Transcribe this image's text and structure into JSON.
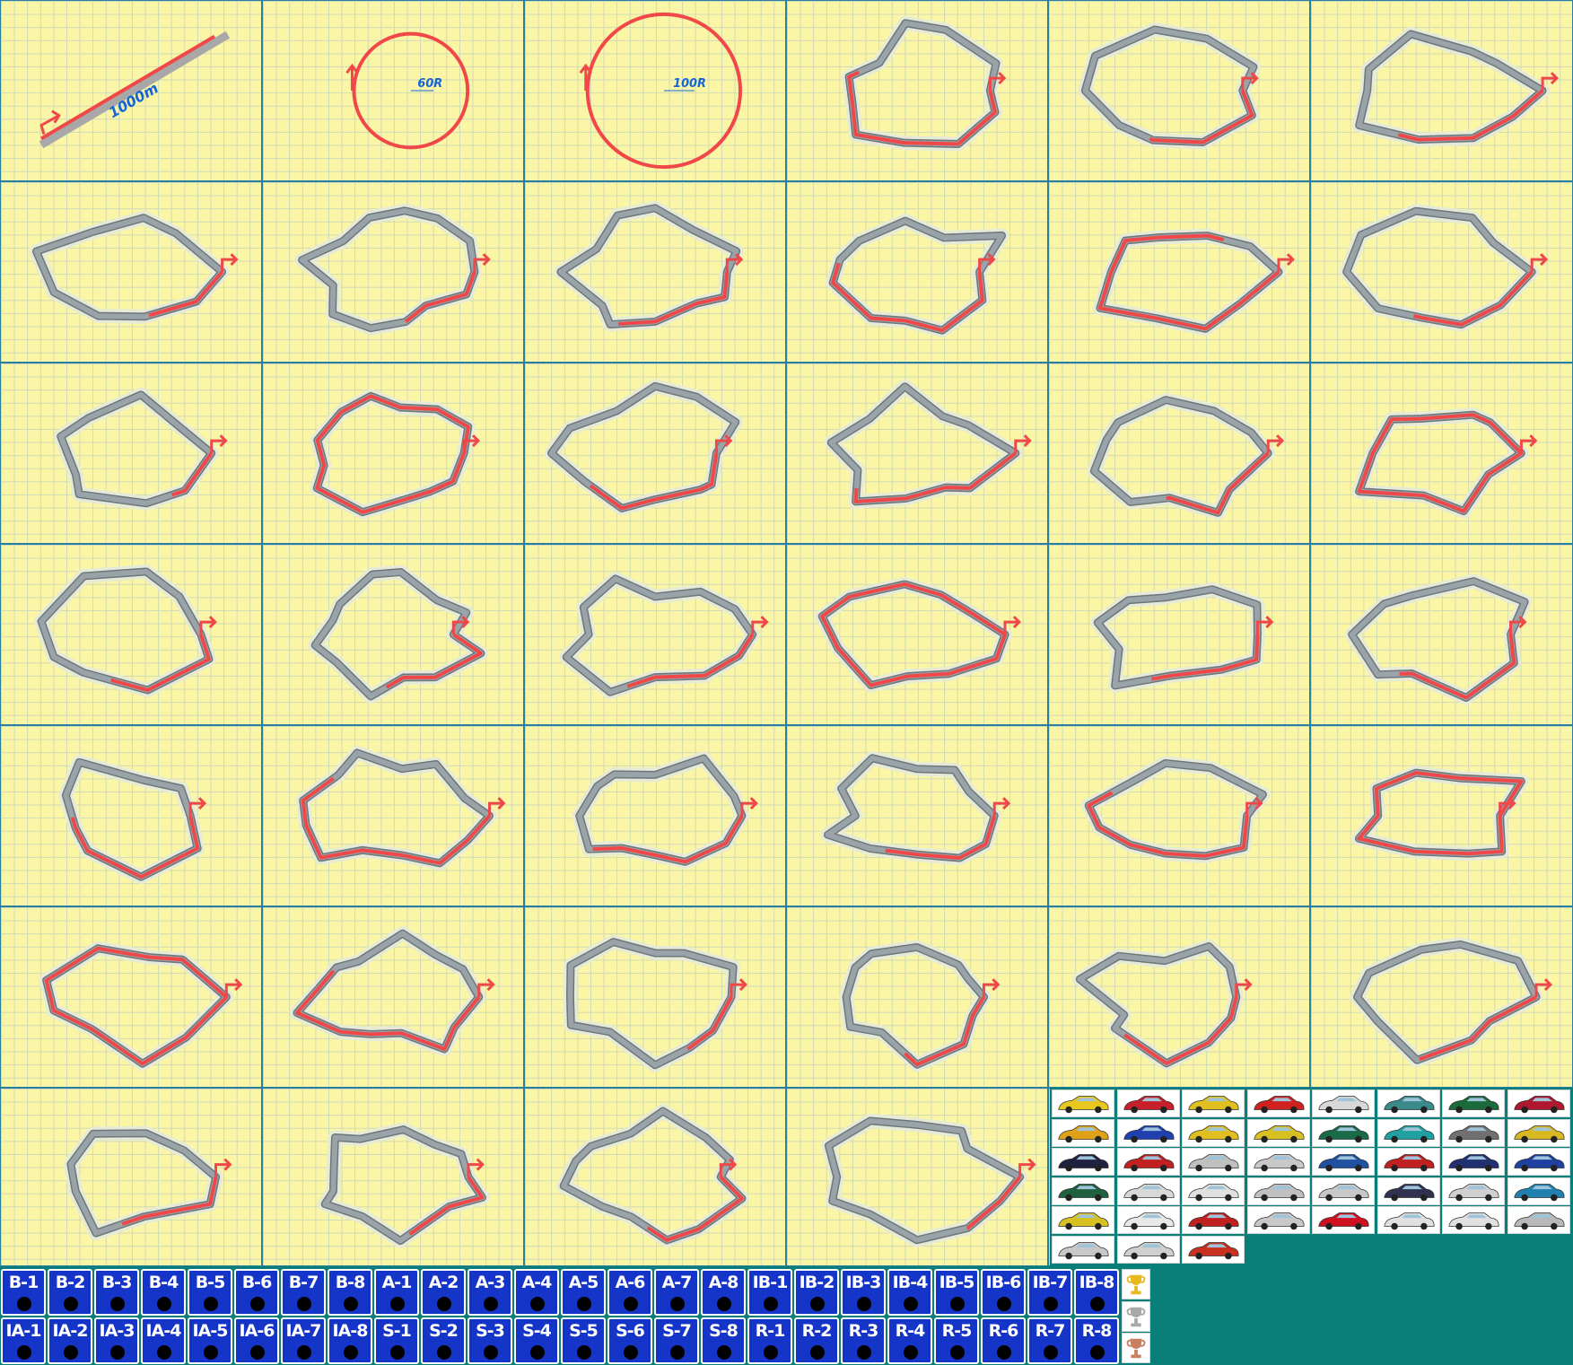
{
  "tracks": [
    {
      "type": "strip",
      "label": "1000m"
    },
    {
      "type": "ring",
      "label": "60R"
    },
    {
      "type": "ring",
      "label": "100R"
    },
    {
      "type": "circuit",
      "seed": 1,
      "highlight": 0.55
    },
    {
      "type": "circuit",
      "seed": 2,
      "highlight": 0.3
    },
    {
      "type": "circuit",
      "seed": 3,
      "highlight": 0.35
    },
    {
      "type": "circuit",
      "seed": 4,
      "highlight": 0.2
    },
    {
      "type": "circuit",
      "seed": 5,
      "highlight": 0.2
    },
    {
      "type": "circuit",
      "seed": 6,
      "highlight": 0.3
    },
    {
      "type": "circuit",
      "seed": 7,
      "highlight": 0.5
    },
    {
      "type": "circuit",
      "seed": 8,
      "highlight": 0.85
    },
    {
      "type": "circuit",
      "seed": 9,
      "highlight": 0.3
    },
    {
      "type": "circuit",
      "seed": 10,
      "highlight": 0.15
    },
    {
      "type": "circuit",
      "seed": 11,
      "highlight": 1
    },
    {
      "type": "circuit",
      "seed": 12,
      "highlight": 0.35
    },
    {
      "type": "circuit",
      "seed": 13,
      "highlight": 0.4
    },
    {
      "type": "circuit",
      "seed": 14,
      "highlight": 0.3
    },
    {
      "type": "circuit",
      "seed": 15,
      "highlight": 1
    },
    {
      "type": "circuit",
      "seed": 16,
      "highlight": 0.3
    },
    {
      "type": "circuit",
      "seed": 17,
      "highlight": 0.3
    },
    {
      "type": "circuit",
      "seed": 18,
      "highlight": 0.3
    },
    {
      "type": "circuit",
      "seed": 19,
      "highlight": 1
    },
    {
      "type": "circuit",
      "seed": 20,
      "highlight": 0.3
    },
    {
      "type": "circuit",
      "seed": 21,
      "highlight": 0.35
    },
    {
      "type": "circuit",
      "seed": 22,
      "highlight": 0.5
    },
    {
      "type": "circuit",
      "seed": 23,
      "highlight": 0.6
    },
    {
      "type": "circuit",
      "seed": 24,
      "highlight": 0.4
    },
    {
      "type": "circuit",
      "seed": 25,
      "highlight": 0.3
    },
    {
      "type": "circuit",
      "seed": 26,
      "highlight": 0.55
    },
    {
      "type": "circuit",
      "seed": 27,
      "highlight": 1
    },
    {
      "type": "circuit",
      "seed": 28,
      "highlight": 1
    },
    {
      "type": "circuit",
      "seed": 29,
      "highlight": 0.6
    },
    {
      "type": "circuit",
      "seed": 30,
      "highlight": 0.15
    },
    {
      "type": "circuit",
      "seed": 31,
      "highlight": 0.3
    },
    {
      "type": "circuit",
      "seed": 32,
      "highlight": 0.35
    },
    {
      "type": "circuit",
      "seed": 33,
      "highlight": 0.3
    },
    {
      "type": "circuit",
      "seed": 34,
      "highlight": 0.3
    },
    {
      "type": "circuit",
      "seed": 35,
      "highlight": 0.25
    },
    {
      "type": "circuit",
      "seed": 36,
      "highlight": 0.3
    },
    {
      "type": "circuit",
      "seed": 37,
      "highlight": 0.15
    },
    {
      "type": "circuit",
      "seed": 38,
      "highlight": 0.15
    },
    {
      "type": "circuit",
      "seed": 39,
      "highlight": 1
    }
  ],
  "colors": {
    "tile_bg": "#fbf5a6",
    "grid": "#cfd9b8",
    "tile_border": "#2a7fa0",
    "track_gray": "#9aa3a8",
    "track_edge": "#6d767b",
    "track_red": "#f04848",
    "label_blue": "#1565d8",
    "badge_blue": "#1534c8",
    "teal_bg": "#0a7f7a"
  },
  "cars": [
    "#e8c81c",
    "#c8202a",
    "#e0c020",
    "#d02020",
    "#d8d8d8",
    "#3a8a8a",
    "#1a6a3a",
    "#b01830",
    "#e0a018",
    "#2040b0",
    "#e0c020",
    "#d8c020",
    "#1a6a4a",
    "#20a0a0",
    "#707070",
    "#d8b820",
    "#202040",
    "#c02020",
    "#c0c0c0",
    "#c8c8c8",
    "#2050a0",
    "#c02020",
    "#203070",
    "#2040a0",
    "#206040",
    "#d8d8d8",
    "#e0e0e0",
    "#c0c0c0",
    "#c8c8c8",
    "#303050",
    "#d0d0d0",
    "#2080b0",
    "#d8c020",
    "#e8e8e8",
    "#c02020",
    "#c8c8c8",
    "#d01020",
    "#e0e0e0",
    "#e0e0e0",
    "#b8b8b8",
    "#c8c8c8",
    "#d0d0d0",
    "#c83020"
  ],
  "badges": [
    "B-1",
    "B-2",
    "B-3",
    "B-4",
    "B-5",
    "B-6",
    "B-7",
    "B-8",
    "A-1",
    "A-2",
    "A-3",
    "A-4",
    "A-5",
    "A-6",
    "A-7",
    "A-8",
    "IB-1",
    "IB-2",
    "IB-3",
    "IB-4",
    "IB-5",
    "IB-6",
    "IB-7",
    "IB-8",
    "IA-1",
    "IA-2",
    "IA-3",
    "IA-4",
    "IA-5",
    "IA-6",
    "IA-7",
    "IA-8",
    "S-1",
    "S-2",
    "S-3",
    "S-4",
    "S-5",
    "S-6",
    "S-7",
    "S-8",
    "R-1",
    "R-2",
    "R-3",
    "R-4",
    "R-5",
    "R-6",
    "R-7",
    "R-8"
  ],
  "trophies": [
    {
      "name": "gold-trophy-icon",
      "color": "#e8b820"
    },
    {
      "name": "silver-trophy-icon",
      "color": "#a8a8a8"
    },
    {
      "name": "bronze-trophy-icon",
      "color": "#c88060"
    }
  ]
}
